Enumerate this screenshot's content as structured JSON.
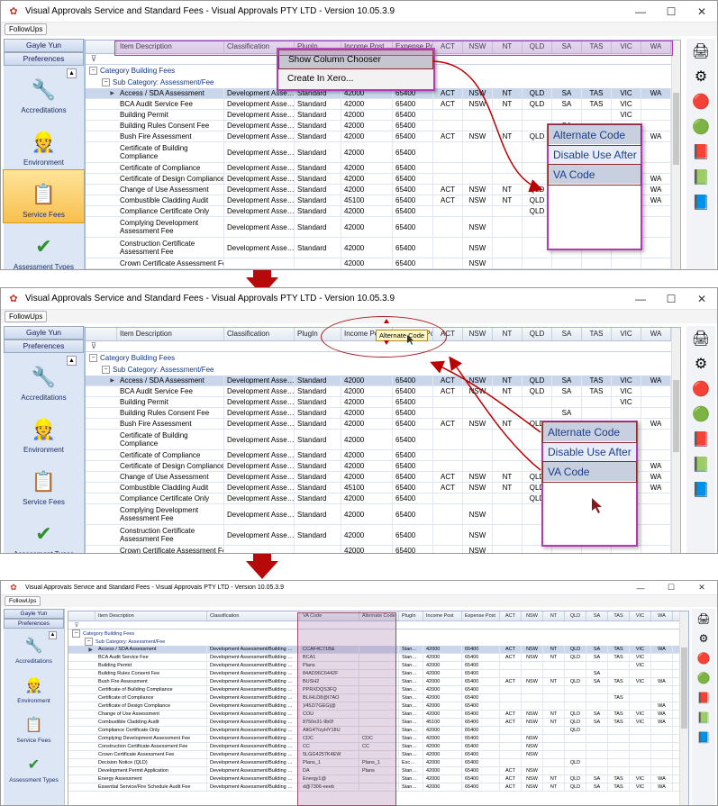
{
  "window": {
    "title": "Visual Approvals Service and Standard Fees - Visual Approvals PTY LTD - Version 10.05.3.9",
    "followups": "FollowUps",
    "minimize": "—",
    "maximize": "☐",
    "close": "✕"
  },
  "nav": {
    "user": "Gayle Yun",
    "preferences": "Preferences",
    "collapse": "▲",
    "items": [
      {
        "label": "Accreditations",
        "icon": "🔧"
      },
      {
        "label": "Environment",
        "icon": "👷"
      },
      {
        "label": "Service Fees",
        "icon": "📋"
      },
      {
        "label": "Assessment Types",
        "icon": "✔"
      }
    ]
  },
  "toolbar": {
    "icons": [
      "🖨",
      "⚙",
      "🔴",
      "🟢",
      "📕",
      "📗",
      "📘"
    ]
  },
  "grid": {
    "category": "Category  Building Fees",
    "subcategory": "Sub Category:  Assessment/Fee",
    "filter_icon": "⊽",
    "states": [
      "ACT",
      "NSW",
      "NT",
      "QLD",
      "SA",
      "TAS",
      "VIC",
      "WA"
    ],
    "col_item": "Item Description",
    "col_class": "Classification",
    "col_plugin": "PlugIn",
    "col_income": "Income Post",
    "col_expense": "Expense Post",
    "col_vacode": "VA Code",
    "col_altcode": "Alternate Code",
    "rows": [
      {
        "desc": "Access / SDA Assessment",
        "cls": "Development Asse…",
        "cls_full": "Development Assessment/Building …",
        "plugin": "Standard",
        "plugin_short": "Stan…",
        "income": "42000",
        "expense": "65400",
        "va": "CCAF4C71B&",
        "alt": "",
        "st": [
          "ACT",
          "NSW",
          "NT",
          "QLD",
          "SA",
          "TAS",
          "VIC",
          "WA"
        ]
      },
      {
        "desc": "BCA Audit Service Fee",
        "cls": "Development Asse…",
        "cls_full": "Development Assessment/Building …",
        "plugin": "Standard",
        "plugin_short": "Stan…",
        "income": "42000",
        "expense": "65400",
        "va": "BCA1",
        "alt": "",
        "st": [
          "ACT",
          "NSW",
          "NT",
          "QLD",
          "SA",
          "TAS",
          "VIC",
          ""
        ]
      },
      {
        "desc": "Building Permit",
        "cls": "Development Asse…",
        "cls_full": "Development Assessment/Building …",
        "plugin": "Standard",
        "plugin_short": "Stan…",
        "income": "42000",
        "expense": "65400",
        "va": "Plans",
        "alt": "",
        "st": [
          "",
          "",
          "",
          "",
          "",
          "",
          "VIC",
          ""
        ]
      },
      {
        "desc": "Building Rules Consent Fee",
        "cls": "Development Asse…",
        "cls_full": "Development Assessment/Building …",
        "plugin": "Standard",
        "plugin_short": "Stan…",
        "income": "42000",
        "expense": "65400",
        "va": "84AD96C6442F",
        "alt": "",
        "st": [
          "",
          "",
          "",
          "",
          "SA",
          "",
          "",
          ""
        ]
      },
      {
        "desc": "Bush Fire Assessment",
        "cls": "Development Asse…",
        "cls_full": "Development Assessment/Building …",
        "plugin": "Standard",
        "plugin_short": "Stan…",
        "income": "42000",
        "expense": "65400",
        "va": "BUSH2",
        "alt": "",
        "st": [
          "ACT",
          "NSW",
          "NT",
          "QLD",
          "SA",
          "TAS",
          "VIC",
          "WA"
        ]
      },
      {
        "desc": "Certificate of Building Compliance",
        "cls": "Development Asse…",
        "cls_full": "Development Assessment/Building …",
        "plugin": "Standard",
        "plugin_short": "Stan…",
        "income": "42000",
        "expense": "65400",
        "va": "PPRXDQS3FQ",
        "alt": "",
        "st": [
          "",
          "",
          "",
          "",
          "",
          "",
          "",
          ""
        ]
      },
      {
        "desc": "Certificate of Compliance",
        "cls": "Development Asse…",
        "cls_full": "Development Assessment/Building …",
        "plugin": "Standard",
        "plugin_short": "Stan…",
        "income": "42000",
        "expense": "65400",
        "va": "BL/HLD8@I7AO",
        "alt": "",
        "st": [
          "",
          "",
          "",
          "",
          "",
          "TAS",
          "",
          ""
        ]
      },
      {
        "desc": "Certificate of Design Compliance",
        "cls": "Development Asse…",
        "cls_full": "Development Assessment/Building …",
        "plugin": "Standard",
        "plugin_short": "Stan…",
        "income": "42000",
        "expense": "65400",
        "va": ")/45Z/7GEG|@",
        "alt": "",
        "st": [
          "",
          "",
          "",
          "",
          "",
          "",
          "",
          "WA"
        ]
      },
      {
        "desc": "Change of Use Assessment",
        "cls": "Development Asse…",
        "cls_full": "Development Assessment/Building …",
        "plugin": "Standard",
        "plugin_short": "Stan…",
        "income": "42000",
        "expense": "65400",
        "va": "COU",
        "alt": "",
        "st": [
          "ACT",
          "NSW",
          "NT",
          "QLD",
          "SA",
          "TAS",
          "VIC",
          "WA"
        ]
      },
      {
        "desc": "Combustible Cladding Audit",
        "cls": "Development Asse…",
        "cls_full": "Development Assessment/Building …",
        "plugin": "Standard",
        "plugin_short": "Stan…",
        "income": "45100",
        "expense": "65400",
        "va": "8750e31-9b0f",
        "alt": "",
        "st": [
          "ACT",
          "NSW",
          "NT",
          "QLD",
          "SA",
          "TAS",
          "VIC",
          "WA"
        ]
      },
      {
        "desc": "Compliance Certificate Only",
        "cls": "Development Asse…",
        "cls_full": "Development Assessment/Building …",
        "plugin": "Standard",
        "plugin_short": "Stan…",
        "income": "42000",
        "expense": "65400",
        "va": "AltG4?/zyHY18U",
        "alt": "",
        "st": [
          "",
          "",
          "",
          "QLD",
          "",
          "",
          "",
          ""
        ]
      },
      {
        "desc": "Complying Development Assessment Fee",
        "cls": "Development Asse…",
        "cls_full": "Development Assessment/Building …",
        "plugin": "Standard",
        "plugin_short": "Stan…",
        "income": "42000",
        "expense": "65400",
        "va": "CDC",
        "alt": "CDC",
        "st": [
          "",
          "NSW",
          "",
          "",
          "",
          "",
          "",
          ""
        ]
      },
      {
        "desc": "Construction Certificate Assessment Fee",
        "cls": "Development Asse…",
        "cls_full": "Development Assessment/Building …",
        "plugin": "Standard",
        "plugin_short": "Stan…",
        "income": "42000",
        "expense": "65400",
        "va": "CC",
        "alt": "CC",
        "st": [
          "",
          "NSW",
          "",
          "",
          "",
          "",
          "",
          ""
        ]
      },
      {
        "desc": "Crown Certificate Assessment Fee",
        "cls": "",
        "cls_full": "Development Assessment/Building …",
        "plugin": "",
        "plugin_short": "Stan…",
        "income": "42000",
        "expense": "65400",
        "va": "5LGG4257K4EW",
        "alt": "",
        "st": [
          "",
          "NSW",
          "",
          "",
          "",
          "",
          "",
          ""
        ]
      },
      {
        "desc": "Decision Notice (QLD)",
        "cls": "",
        "cls_full": "Development Assessment/Building …",
        "plugin": "",
        "plugin_short": "Exc…",
        "income": "42000",
        "expense": "65400",
        "va": "Plans_1",
        "alt": "Plans_1",
        "st": [
          "",
          "",
          "",
          "QLD",
          "",
          "",
          "",
          ""
        ]
      },
      {
        "desc": "Development Permit Application",
        "cls": "",
        "cls_full": "Development Assessment/Building …",
        "plugin": "",
        "plugin_short": "Stan…",
        "income": "42000",
        "expense": "65400",
        "va": "DA",
        "alt": "Plans",
        "st": [
          "ACT",
          "NSW",
          "",
          "",
          "",
          "",
          "",
          ""
        ]
      },
      {
        "desc": "Energy Assessment",
        "cls": "",
        "cls_full": "Development Assessment/Building …",
        "plugin": "",
        "plugin_short": "Stan…",
        "income": "42000",
        "expense": "65400",
        "va": "Energy1@",
        "alt": "",
        "st": [
          "ACT",
          "NSW",
          "NT",
          "QLD",
          "SA",
          "TAS",
          "VIC",
          "WA"
        ]
      },
      {
        "desc": "Essential Service/Fire Schedule Audit Fee",
        "cls": "",
        "cls_full": "Development Assessment/Building …",
        "plugin": "",
        "plugin_short": "Stan…",
        "income": "42000",
        "expense": "65400",
        "va": "d@7306-eeeb",
        "alt": "",
        "st": [
          "ACT",
          "NSW",
          "NT",
          "QLD",
          "SA",
          "TAS",
          "VIC",
          "WA"
        ]
      }
    ]
  },
  "context_menu": {
    "item1": "Show Column Chooser",
    "item2": "Create In Xero..."
  },
  "chooser": {
    "items": [
      "Alternate Code",
      "Disable Use After",
      "VA Code"
    ]
  },
  "drag_label": "Alternate Code"
}
